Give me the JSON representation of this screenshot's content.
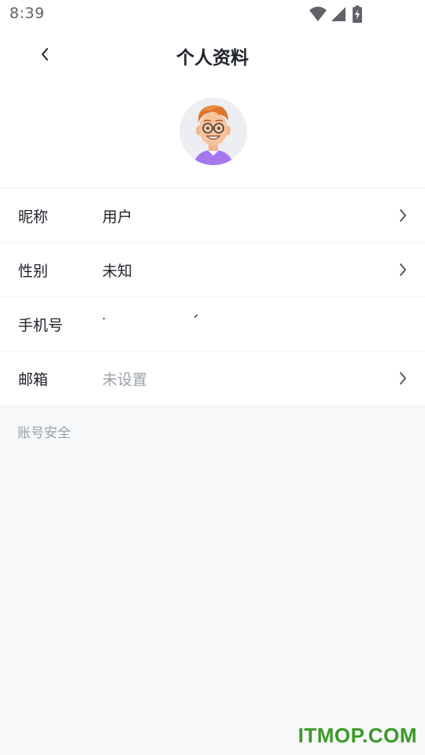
{
  "status_bar": {
    "time": "8:39",
    "icons": [
      "wifi-icon",
      "cellular-signal-icon",
      "battery-charging-icon"
    ]
  },
  "header": {
    "title": "个人资料",
    "back_icon": "chevron-left-icon"
  },
  "avatar": {
    "icon": "cartoon-avatar"
  },
  "profile_rows": [
    {
      "label": "昵称",
      "value": "用户",
      "has_chevron": true
    },
    {
      "label": "性别",
      "value": "未知",
      "has_chevron": true
    },
    {
      "label": "手机号",
      "value": "",
      "has_chevron": false
    },
    {
      "label": "邮箱",
      "value": "未设置",
      "has_chevron": true
    }
  ],
  "section": {
    "account_security": "账号安全"
  },
  "watermark": "ITMOP.COM",
  "colors": {
    "text_primary": "#1d2129",
    "text_secondary": "#9aa0a8",
    "page_background": "#f7f8fa",
    "card_background": "#ffffff",
    "watermark": "#3a9a26"
  }
}
